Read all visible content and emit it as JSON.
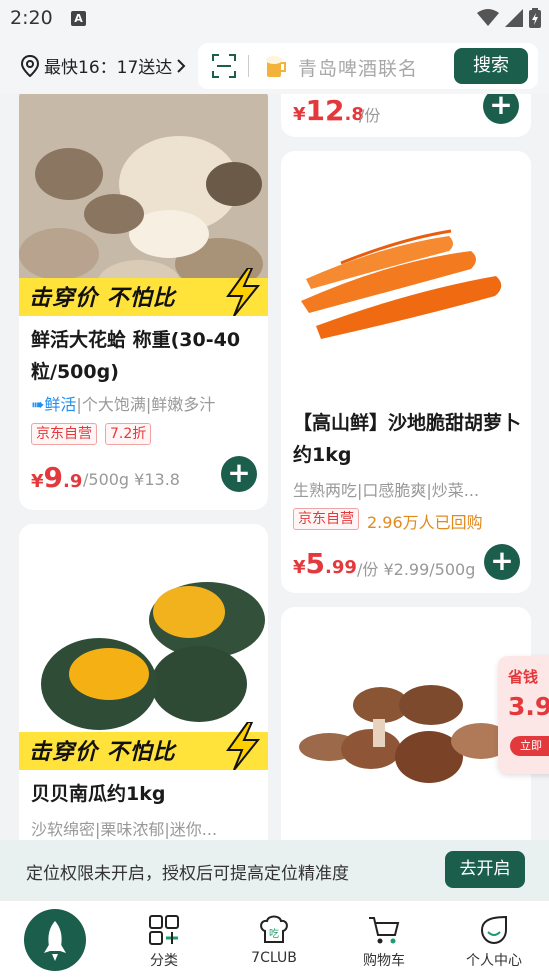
{
  "status_bar": {
    "time": "2:20",
    "notification_badge": "A"
  },
  "header": {
    "location_text": "最快16：17送达",
    "search_placeholder": "青岛啤酒联名",
    "search_button": "搜索"
  },
  "products": [
    {
      "name": "partial-top",
      "price_yen": "¥",
      "price_int": "12",
      "price_dec": ".8",
      "unit": "/份"
    },
    {
      "name": "clam",
      "banner": "击穿价 不怕比",
      "title": "鲜活大花蛤  称重(30-40粒/500g)",
      "fresh_label": "➠鲜活",
      "subtitle": "|个大饱满|鲜嫩多汁",
      "tags": [
        "京东自营",
        "7.2折"
      ],
      "price_yen": "¥",
      "price_int": "9",
      "price_dec": ".9",
      "unit": "/500g ¥13.8"
    },
    {
      "name": "carrot",
      "title": "【高山鲜】沙地脆甜胡萝卜约1kg",
      "subtitle": "生熟两吃|口感脆爽|炒菜...",
      "tags": [
        "京东自营"
      ],
      "repurchase": "2.96万人已回购",
      "price_yen": "¥",
      "price_int": "5",
      "price_dec": ".99",
      "unit": "/份 ¥2.99/500g"
    },
    {
      "name": "pumpkin",
      "banner": "击穿价 不怕比",
      "title": "贝贝南瓜约1kg",
      "subtitle": "沙软绵密|栗味浓郁|迷你..."
    },
    {
      "name": "mushroom"
    }
  ],
  "coupon": {
    "line1": "省钱",
    "line2": "3.9",
    "line3": "立即"
  },
  "permission_bar": {
    "message": "定位权限未开启，授权后可提高定位精准度",
    "button": "去开启"
  },
  "tabbar": {
    "tabs": [
      {
        "label": "分类",
        "icon": "category-icon"
      },
      {
        "label": "7CLUB",
        "icon": "chef-hat-icon"
      },
      {
        "label": "购物车",
        "icon": "cart-icon"
      },
      {
        "label": "个人中心",
        "icon": "profile-icon"
      }
    ]
  },
  "colors": {
    "brand_green": "#1b5e4b",
    "price_red": "#e4393c",
    "banner_yellow": "#ffe23a"
  }
}
